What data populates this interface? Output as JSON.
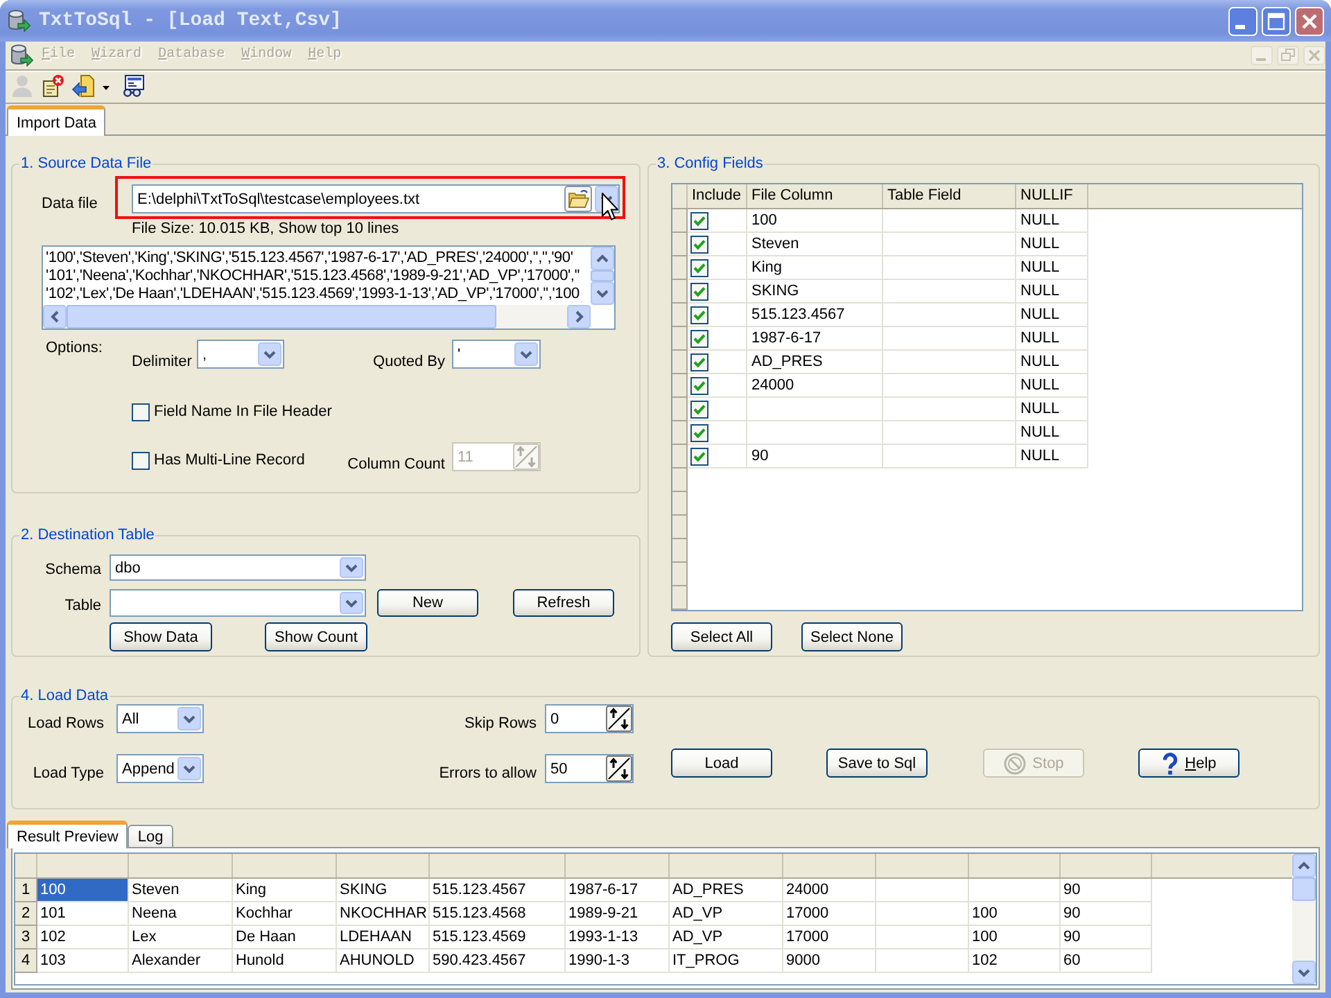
{
  "window": {
    "title": "TxtToSql - [Load Text,Csv]"
  },
  "menu": [
    {
      "mnemonic": "F",
      "rest": "ile",
      "disabled": true
    },
    {
      "mnemonic": "W",
      "rest": "izard",
      "disabled": true
    },
    {
      "mnemonic": "D",
      "rest": "atabase",
      "disabled": true
    },
    {
      "mnemonic": "W",
      "rest": "indow",
      "disabled": true
    },
    {
      "mnemonic": "H",
      "rest": "elp",
      "disabled": true
    }
  ],
  "toolbar": [
    {
      "kind": "user",
      "disabled": true,
      "dropdown": false
    },
    {
      "kind": "page_delete",
      "disabled": false,
      "dropdown": false
    },
    {
      "kind": "import",
      "disabled": false,
      "dropdown": true
    },
    {
      "kind": "preview",
      "disabled": false,
      "dropdown": false
    }
  ],
  "tabs": [
    {
      "label": "Import Data",
      "selected": true
    }
  ],
  "source_data_file": {
    "legend": "1. Source Data File",
    "data_file": {
      "label": "Data file",
      "value": "E:\\delphi\\TxtToSql\\testcase\\employees.txt",
      "highlighted": true
    },
    "file_info": "File Size: 10.015 KB, Show top 10 lines",
    "preview_lines": [
      "'100','Steven','King','SKING','515.123.4567','1987-6-17','AD_PRES','24000','','','90'",
      "'101','Neena','Kochhar','NKOCHHAR','515.123.4568','1989-9-21','AD_VP','17000',''",
      "'102','Lex','De Haan','LDEHAAN','515.123.4569','1993-1-13','AD_VP','17000','','100"
    ],
    "options_label": "Options:",
    "delimiter": {
      "label": "Delimiter",
      "value": ","
    },
    "quoted_by": {
      "label": "Quoted By",
      "value": "'"
    },
    "field_name_in_header": {
      "label": "Field Name In File Header",
      "checked": false
    },
    "multi_line_record": {
      "label": "Has Multi-Line Record",
      "checked": false
    },
    "column_count": {
      "label": "Column Count",
      "value": "11",
      "disabled": true
    }
  },
  "destination_table": {
    "legend": "2. Destination Table",
    "schema": {
      "label": "Schema",
      "value": "dbo"
    },
    "table": {
      "label": "Table"
    },
    "new_button": "New",
    "refresh_button": "Refresh",
    "show_data_button": "Show Data",
    "show_count_button": "Show Count"
  },
  "config_fields": {
    "legend": "3. Config Fields",
    "columns": [
      "Include",
      "File Column",
      "Table Field",
      "NULLIF"
    ],
    "rows": [
      {
        "include": true,
        "file_column": "100",
        "nullif": "NULL"
      },
      {
        "include": true,
        "file_column": "Steven",
        "nullif": "NULL"
      },
      {
        "include": true,
        "file_column": "King",
        "nullif": "NULL"
      },
      {
        "include": true,
        "file_column": "SKING",
        "nullif": "NULL"
      },
      {
        "include": true,
        "file_column": "515.123.4567",
        "nullif": "NULL"
      },
      {
        "include": true,
        "file_column": "1987-6-17",
        "nullif": "NULL"
      },
      {
        "include": true,
        "file_column": "AD_PRES",
        "nullif": "NULL"
      },
      {
        "include": true,
        "file_column": "24000",
        "nullif": "NULL"
      },
      {
        "include": true,
        "nullif": "NULL"
      },
      {
        "include": true,
        "nullif": "NULL"
      },
      {
        "include": true,
        "file_column": "90",
        "nullif": "NULL"
      }
    ],
    "select_all_button": "Select All",
    "select_none_button": "Select None"
  },
  "load_data": {
    "legend": "4. Load Data",
    "load_rows": {
      "label": "Load Rows",
      "value": "All"
    },
    "load_type": {
      "label": "Load Type",
      "value": "Append"
    },
    "skip_rows": {
      "label": "Skip Rows",
      "value": "0"
    },
    "errors_to_allow": {
      "label": "Errors to allow",
      "value": "50"
    },
    "buttons": [
      {
        "kind": "load",
        "label": "Load",
        "disabled": false
      },
      {
        "kind": "save",
        "label": "Save to Sql",
        "disabled": false
      },
      {
        "kind": "stop",
        "label": "Stop",
        "disabled": true
      },
      {
        "kind": "help",
        "mnemonic": "H",
        "label": "elp",
        "disabled": false
      }
    ]
  },
  "result_tabs": [
    {
      "label": "Result Preview",
      "selected": true
    },
    {
      "label": "Log",
      "selected": false
    }
  ],
  "result_grid": {
    "rows": [
      {
        "number": "1",
        "cells": [
          {
            "text": "100",
            "selected": true
          },
          {
            "text": "Steven",
            "selected": false
          },
          {
            "text": "King",
            "selected": false
          },
          {
            "text": "SKING",
            "selected": false
          },
          {
            "text": "515.123.4567",
            "selected": false
          },
          {
            "text": "1987-6-17",
            "selected": false
          },
          {
            "text": "AD_PRES",
            "selected": false
          },
          {
            "text": "24000",
            "selected": false
          },
          {
            "selected": false
          },
          {
            "selected": false
          },
          {
            "text": "90",
            "selected": false
          }
        ]
      },
      {
        "number": "2",
        "cells": [
          {
            "text": "101",
            "selected": false
          },
          {
            "text": "Neena",
            "selected": false
          },
          {
            "text": "Kochhar",
            "selected": false
          },
          {
            "text": "NKOCHHAR",
            "selected": false
          },
          {
            "text": "515.123.4568",
            "selected": false
          },
          {
            "text": "1989-9-21",
            "selected": false
          },
          {
            "text": "AD_VP",
            "selected": false
          },
          {
            "text": "17000",
            "selected": false
          },
          {
            "selected": false
          },
          {
            "text": "100",
            "selected": false
          },
          {
            "text": "90",
            "selected": false
          }
        ]
      },
      {
        "number": "3",
        "cells": [
          {
            "text": "102",
            "selected": false
          },
          {
            "text": "Lex",
            "selected": false
          },
          {
            "text": "De Haan",
            "selected": false
          },
          {
            "text": "LDEHAAN",
            "selected": false
          },
          {
            "text": "515.123.4569",
            "selected": false
          },
          {
            "text": "1993-1-13",
            "selected": false
          },
          {
            "text": "AD_VP",
            "selected": false
          },
          {
            "text": "17000",
            "selected": false
          },
          {
            "selected": false
          },
          {
            "text": "100",
            "selected": false
          },
          {
            "text": "90",
            "selected": false
          }
        ]
      },
      {
        "number": "4",
        "cells": [
          {
            "text": "103",
            "selected": false
          },
          {
            "text": "Alexander",
            "selected": false
          },
          {
            "text": "Hunold",
            "selected": false
          },
          {
            "text": "AHUNOLD",
            "selected": false
          },
          {
            "text": "590.423.4567",
            "selected": false
          },
          {
            "text": "1990-1-3",
            "selected": false
          },
          {
            "text": "IT_PROG",
            "selected": false
          },
          {
            "text": "9000",
            "selected": false
          },
          {
            "selected": false
          },
          {
            "text": "102",
            "selected": false
          },
          {
            "text": "60",
            "selected": false
          }
        ]
      }
    ]
  }
}
